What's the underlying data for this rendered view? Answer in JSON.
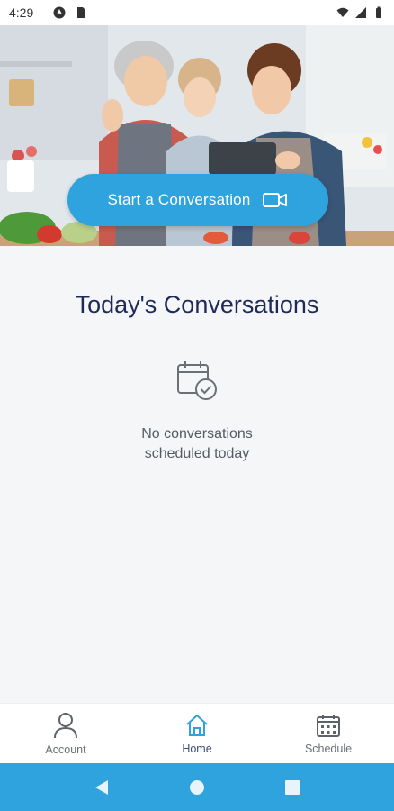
{
  "status_bar": {
    "time": "4:29",
    "left_icons": [
      "location-icon",
      "sim-card-icon"
    ],
    "right_icons": [
      "wifi-icon",
      "signal-icon",
      "battery-icon"
    ]
  },
  "hero": {
    "image": "family-kitchen-photo",
    "start_button_label": "Start a Conversation",
    "start_button_icon": "video-camera-icon"
  },
  "main": {
    "title": "Today's Conversations",
    "empty_icon": "calendar-check-icon",
    "empty_line1": "No conversations",
    "empty_line2": "scheduled today"
  },
  "bottom_nav": {
    "items": [
      {
        "label": "Account",
        "icon": "person-icon"
      },
      {
        "label": "Home",
        "icon": "home-icon"
      },
      {
        "label": "Schedule",
        "icon": "calendar-icon"
      }
    ],
    "active": "Home"
  },
  "system_nav": [
    "back-icon",
    "home-circle-icon",
    "recents-icon"
  ],
  "colors": {
    "accent": "#2ea3dd",
    "title": "#1f2a5a",
    "background": "#f4f6f8"
  }
}
